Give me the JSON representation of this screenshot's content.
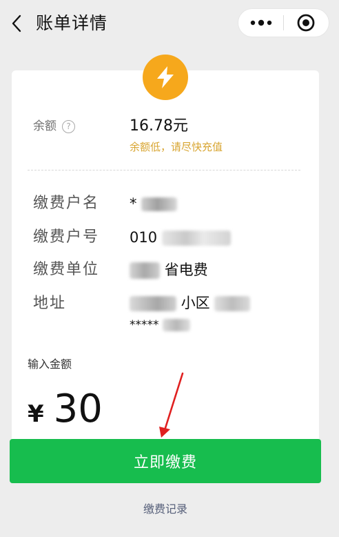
{
  "nav": {
    "title": "账单详情",
    "back_icon": "chevron-left-icon",
    "more_icon": "more-dots-icon",
    "close_icon": "target-icon"
  },
  "header_icon": "lightning-bolt-icon",
  "balance": {
    "label": "余额",
    "help_icon": "question-circle-icon",
    "value": "16.78元",
    "warning": "余额低，请尽快充值"
  },
  "info": [
    {
      "label": "缴费户名",
      "value_visible": "*"
    },
    {
      "label": "缴费户号",
      "value_visible": "010"
    },
    {
      "label": "缴费单位",
      "value_visible": "省电费"
    },
    {
      "label": "地址",
      "value_visible": "小区",
      "value_line2": "*****"
    }
  ],
  "amount": {
    "label": "输入金额",
    "currency": "¥",
    "value": "30"
  },
  "actions": {
    "pay_label": "立即缴费",
    "record_label": "缴费记录"
  },
  "colors": {
    "accent_green": "#17bd4e",
    "warning_gold": "#d8a531",
    "icon_orange": "#f6a81c",
    "arrow_red": "#e02020"
  }
}
